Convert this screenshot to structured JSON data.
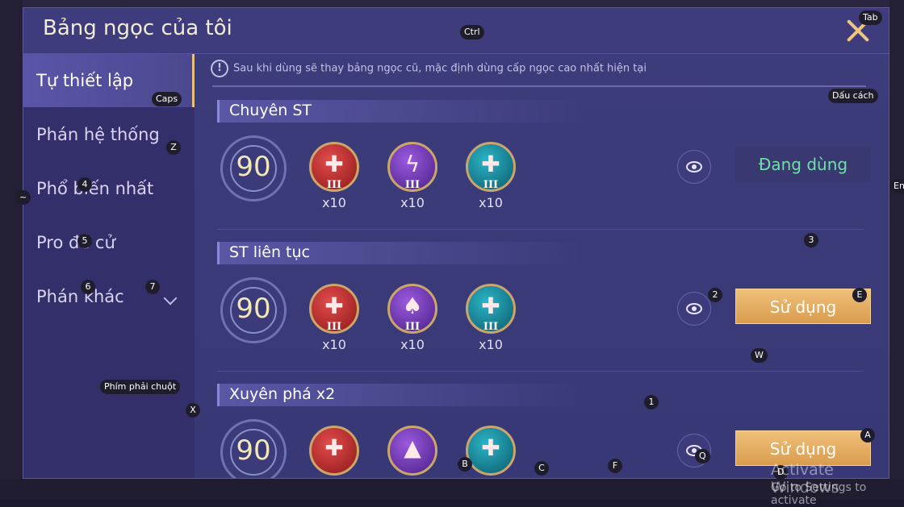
{
  "dialog": {
    "title": "Bảng ngọc của tôi",
    "notice": "Sau khi dùng sẽ thay bảng ngọc cũ, mặc định dùng cấp ngọc cao nhất hiện tại",
    "notice_icon": "!"
  },
  "sidebar": {
    "items": [
      {
        "label": "Tự thiết lập"
      },
      {
        "label": "Phán hệ thống"
      },
      {
        "label": "Phổ biến nhất"
      },
      {
        "label": "Pro đề cử"
      },
      {
        "label": "Phán khác"
      }
    ]
  },
  "sections": [
    {
      "title": "Chuyên ST",
      "level": "90",
      "gems": [
        {
          "color": "red",
          "glyph": "✚",
          "tier": "III",
          "qty": "x10"
        },
        {
          "color": "purple",
          "glyph": "ϟ",
          "tier": "III",
          "qty": "x10"
        },
        {
          "color": "teal",
          "glyph": "✚",
          "tier": "III",
          "qty": "x10"
        }
      ],
      "action": "Đang dùng"
    },
    {
      "title": "ST liên tục",
      "level": "90",
      "gems": [
        {
          "color": "red",
          "glyph": "✚",
          "tier": "III",
          "qty": "x10"
        },
        {
          "color": "purple",
          "glyph": "♠",
          "tier": "III",
          "qty": "x10"
        },
        {
          "color": "teal",
          "glyph": "✚",
          "tier": "III",
          "qty": "x10"
        }
      ],
      "action": "Sử dụng"
    },
    {
      "title": "Xuyên phá x2",
      "level": "90",
      "gems": [
        {
          "color": "red",
          "glyph": "✚",
          "tier": "",
          "qty": ""
        },
        {
          "color": "purple",
          "glyph": "▲",
          "tier": "",
          "qty": ""
        },
        {
          "color": "teal",
          "glyph": "✚",
          "tier": "",
          "qty": ""
        }
      ],
      "action": "Sử dụng"
    }
  ],
  "keyhints": {
    "tab": "Tab",
    "ctrl": "Ctrl",
    "caps": "Caps",
    "space": "Dấu cách",
    "enter": "En",
    "tilde": "~",
    "z": "Z",
    "k4": "4",
    "k5": "5",
    "k6": "6",
    "k7": "7",
    "k3": "3",
    "k2": "2",
    "e": "E",
    "w": "W",
    "right_click": "Phím phải chuột",
    "x": "X",
    "k1": "1",
    "a": "A",
    "b": "B",
    "c": "C",
    "f": "F",
    "q": "Q",
    "d": "D"
  },
  "watermark": {
    "line1": "Activate Windows",
    "line2": "Go to Settings to activate"
  },
  "colors": {
    "panel": "#3e3c7c",
    "sidebar": "#332f6b",
    "accent_gold": "#f0c67c",
    "using_green": "#6ee0a8"
  }
}
